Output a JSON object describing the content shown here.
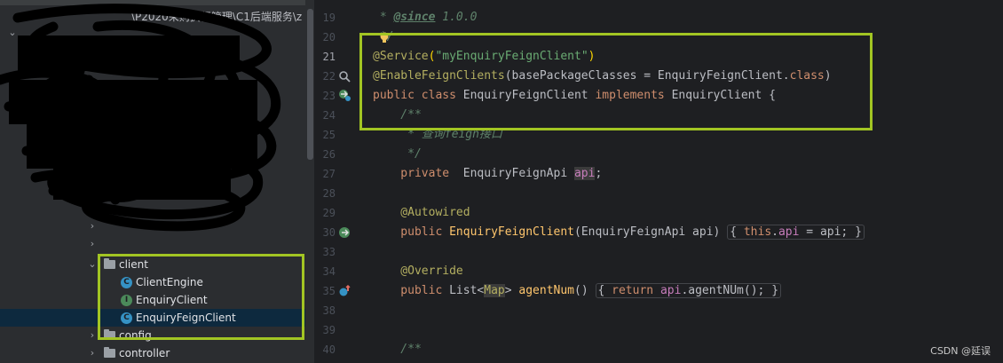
{
  "project_tree": {
    "path_fragment": "\\P2020采购执行管理\\C1后端服务\\z",
    "items": [
      {
        "label": "client",
        "type": "folder",
        "expanded": true
      },
      {
        "label": "ClientEngine",
        "type": "class"
      },
      {
        "label": "EnquiryClient",
        "type": "interface"
      },
      {
        "label": "EnquiryFeignClient",
        "type": "class",
        "selected": true
      },
      {
        "label": "config",
        "type": "folder",
        "expanded": false
      },
      {
        "label": "controller",
        "type": "folder",
        "expanded": false
      }
    ]
  },
  "editor": {
    "line_numbers": [
      "19",
      "20",
      "21",
      "22",
      "23",
      "24",
      "25",
      "26",
      "27",
      "28",
      "29",
      "30",
      "33",
      "34",
      "35",
      "38",
      "39",
      "40"
    ],
    "current_line": "21",
    "code": {
      "l19": {
        "star": " * ",
        "tag": "@since",
        "rest": " 1.0.0"
      },
      "l20": {
        "rest": " */"
      },
      "l21": {
        "ann": "@Service",
        "open": "(",
        "str": "\"myEnquiryFeignClient\"",
        "close": ")"
      },
      "l22": {
        "ann": "@EnableFeignClients",
        "rest": "(basePackageClasses = EnquiryFeignClient.",
        "kw": "class",
        "close": ")"
      },
      "l23": {
        "kw1": "public class",
        "name": " EnquiryFeignClient ",
        "kw2": "implements",
        "rest": " EnquiryClient {"
      },
      "l24": {
        "doc": "    /**"
      },
      "l25": {
        "doc": "     * 查询feign接口"
      },
      "l26": {
        "doc": "     */"
      },
      "l27": {
        "kw": "    private",
        "type": "  EnquiryFeignApi ",
        "field": "api",
        "end": ";"
      },
      "l29": {
        "ann": "    @Autowired"
      },
      "l30": {
        "kw": "    public",
        "name": " EnquiryFeignClient",
        "params": "(EnquiryFeignApi api) ",
        "body_open": "{ ",
        "this_kw": "this",
        "dot": ".",
        "field": "api",
        "assign": " = api; ",
        "body_close": "}"
      },
      "l34": {
        "ann": "    @Override"
      },
      "l35": {
        "kw": "    public",
        "t1": " List<",
        "t2": "Map",
        "t3": "> ",
        "name": "agentNum",
        "paren": "() ",
        "body_open": "{ ",
        "ret": "return",
        "sp": " ",
        "field": "api",
        "call": ".agentNUm(); ",
        "body_close": "}"
      },
      "l40": {
        "doc": "    /**"
      }
    }
  },
  "watermark": "CSDN @延误",
  "colors": {
    "highlight": "#a2c523",
    "background": "#1e1f22",
    "tree_background": "#2b2d30",
    "selection": "#0d293e"
  }
}
